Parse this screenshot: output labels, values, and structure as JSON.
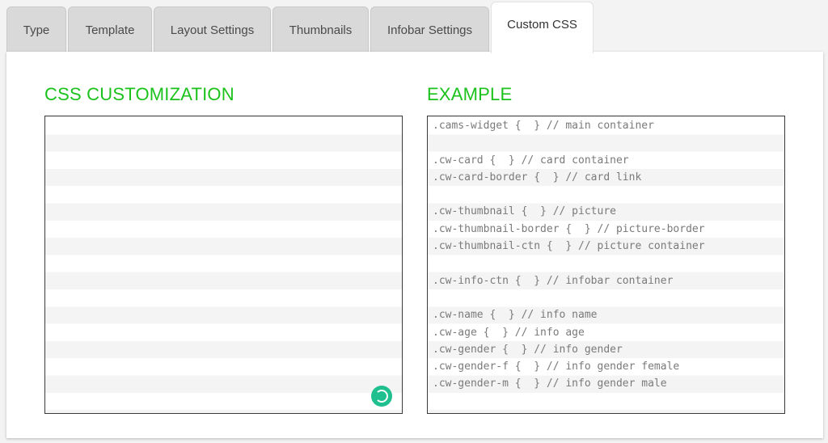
{
  "tabs": [
    {
      "label": "Type"
    },
    {
      "label": "Template"
    },
    {
      "label": "Layout Settings"
    },
    {
      "label": "Thumbnails"
    },
    {
      "label": "Infobar Settings"
    },
    {
      "label": "Custom CSS",
      "active": true
    }
  ],
  "css_section": {
    "title": "CSS CUSTOMIZATION",
    "editor_value": ""
  },
  "example_section": {
    "title": "EXAMPLE",
    "lines": [
      ".cams-widget {  } // main container",
      "",
      ".cw-card {  } // card container",
      ".cw-card-border {  } // card link",
      "",
      ".cw-thumbnail {  } // picture",
      ".cw-thumbnail-border {  } // picture-border",
      ".cw-thumbnail-ctn {  } // picture container",
      "",
      ".cw-info-ctn {  } // infobar container",
      "",
      ".cw-name {  } // info name",
      ".cw-age {  } // info age",
      ".cw-gender {  } // info gender",
      ".cw-gender-f {  } // info gender female",
      ".cw-gender-m {  } // info gender male"
    ]
  },
  "colors": {
    "accent": "#1bc21b",
    "spinner": "#1fbf8f"
  },
  "icons": {
    "spinner": "loading-spinner-icon"
  }
}
